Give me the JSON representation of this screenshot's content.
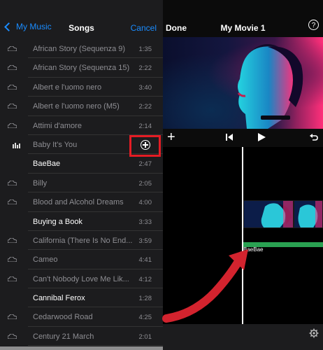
{
  "colors": {
    "accent": "#1a8cff",
    "highlight": "#e41c24",
    "audio_track": "#2aa152"
  },
  "music_panel": {
    "back_label": "My Music",
    "title": "Songs",
    "cancel_label": "Cancel",
    "songs": [
      {
        "title": "African Story (Sequenza 9)",
        "duration": "1:35",
        "icon": "cloud-icon",
        "available": false
      },
      {
        "title": "African Story (Sequenza 15)",
        "duration": "2:22",
        "icon": "cloud-icon",
        "available": false
      },
      {
        "title": "Albert e l'uomo nero",
        "duration": "3:40",
        "icon": "cloud-icon",
        "available": false
      },
      {
        "title": "Albert e l'uomo nero (M5)",
        "duration": "2:22",
        "icon": "cloud-icon",
        "available": false
      },
      {
        "title": "Attimi d'amore",
        "duration": "2:14",
        "icon": "cloud-icon",
        "available": false
      },
      {
        "title": "Baby It's You",
        "duration": "",
        "icon": "playing-bars-icon",
        "available": false
      },
      {
        "title": "BaeBae",
        "duration": "2:47",
        "icon": "",
        "available": true
      },
      {
        "title": "Billy",
        "duration": "2:05",
        "icon": "cloud-icon",
        "available": false
      },
      {
        "title": "Blood and Alcohol Dreams",
        "duration": "4:00",
        "icon": "cloud-icon",
        "available": false
      },
      {
        "title": "Buying a Book",
        "duration": "3:33",
        "icon": "",
        "available": true
      },
      {
        "title": "California (There Is No End...",
        "duration": "3:59",
        "icon": "cloud-icon",
        "available": false
      },
      {
        "title": "Cameo",
        "duration": "4:41",
        "icon": "cloud-icon",
        "available": false
      },
      {
        "title": "Can't Nobody Love Me Lik...",
        "duration": "4:12",
        "icon": "cloud-icon",
        "available": false
      },
      {
        "title": "Cannibal Ferox",
        "duration": "1:28",
        "icon": "",
        "available": true
      },
      {
        "title": "Cedarwood Road",
        "duration": "4:25",
        "icon": "cloud-icon",
        "available": false
      },
      {
        "title": "Century 21 March",
        "duration": "2:01",
        "icon": "cloud-icon",
        "available": false
      }
    ]
  },
  "editor": {
    "done_label": "Done",
    "title": "My Movie 1",
    "help_icon": "?",
    "audio_clip_label": "BaeBae"
  }
}
